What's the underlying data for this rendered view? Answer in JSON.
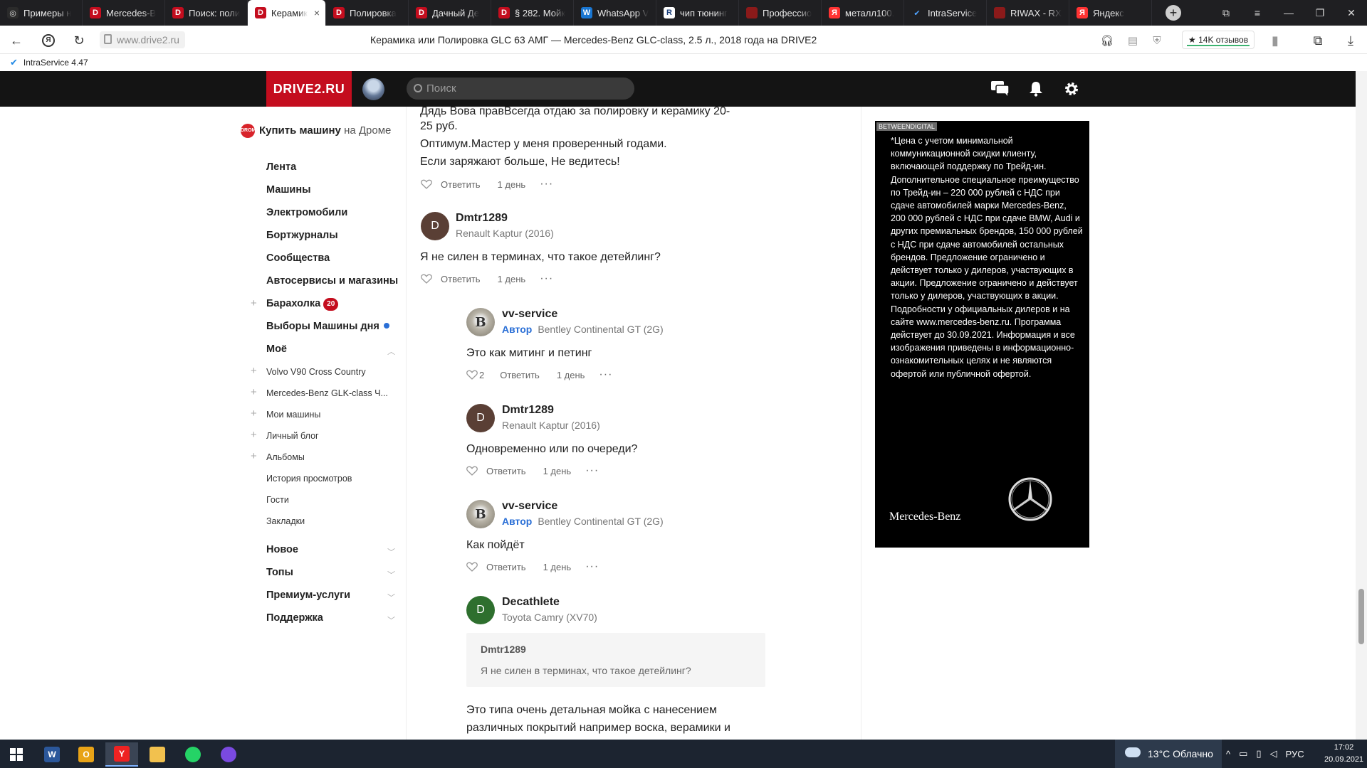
{
  "browser": {
    "tabs": [
      {
        "label": "Примеры н",
        "icon": "settings-icon",
        "color": "#2b2b2b"
      },
      {
        "label": "Mercedes-B",
        "icon": "drive2-icon",
        "color": "#c40d1e"
      },
      {
        "label": "Поиск: поли",
        "icon": "drive2-icon",
        "color": "#c40d1e"
      },
      {
        "label": "Керамик",
        "icon": "drive2-icon",
        "color": "#c40d1e",
        "active": true
      },
      {
        "label": "Полировка",
        "icon": "drive2-icon",
        "color": "#c40d1e"
      },
      {
        "label": "Дачный Де",
        "icon": "drive2-icon",
        "color": "#c40d1e"
      },
      {
        "label": "§ 282. Мойк",
        "icon": "drive2-icon",
        "color": "#c40d1e"
      },
      {
        "label": "WhatsApp V",
        "icon": "whatsapp-web-icon",
        "color": "#1976d2"
      },
      {
        "label": "чип тюнинг",
        "icon": "chip-icon",
        "color": "#ffffff"
      },
      {
        "label": "Профессио",
        "icon": "pdf-icon",
        "color": "#8b1a1a"
      },
      {
        "label": "металл100.",
        "icon": "yandex-icon",
        "color": "#f33"
      },
      {
        "label": "IntraService",
        "icon": "check-icon",
        "color": "#1e88e5"
      },
      {
        "label": "RIWAX - RX",
        "icon": "riwax-icon",
        "color": "#8b1a1a"
      },
      {
        "label": "Яндекс",
        "icon": "yandex-icon",
        "color": "#f33"
      }
    ],
    "url": "www.drive2.ru",
    "page_title": "Керамика или Полировка GLC 63 АМГ — Mercedes-Benz GLC-class, 2.5 л., 2018 года на DRIVE2",
    "reviews": "★ 14K отзывов",
    "bookmark": "IntraService 4.47",
    "new_tab": "+",
    "tab_close": "×"
  },
  "header": {
    "logo": "DRIVE2.RU",
    "search_placeholder": "Поиск"
  },
  "sidebar": {
    "buy": {
      "drom_icon": "DROM",
      "bold": "Купить машину",
      "rest": "на Дроме"
    },
    "main_items": [
      {
        "label": "Лента"
      },
      {
        "label": "Машины"
      },
      {
        "label": "Электромобили"
      },
      {
        "label": "Бортжурналы"
      },
      {
        "label": "Сообщества"
      },
      {
        "label": "Автосервисы и магазины"
      },
      {
        "label": "Барахолка",
        "badge": "20"
      },
      {
        "label": "Выборы Машины дня"
      }
    ],
    "my_title": "Моё",
    "my_items": [
      "Volvo V90 Cross Country",
      "Mercedes-Benz GLK-class Ч...",
      "Мои машины",
      "Личный блог",
      "Альбомы",
      "История просмотров",
      "Гости",
      "Закладки"
    ],
    "sections": [
      "Новое",
      "Топы",
      "Премиум-услуги",
      "Поддержка"
    ]
  },
  "comments": {
    "c0": {
      "lines": [
        "Дядь Вова правВсегда отдаю за полировку и керамику 20-",
        "25 руб.",
        "Оптимум.Мастер у меня проверенный годами.",
        "Если заряжают больше, Не ведитесь!"
      ],
      "reply": "Ответить",
      "date": "1 день",
      "more": "···"
    },
    "c1": {
      "initial": "D",
      "user": "Dmtr1289",
      "car": "Renault Kaptur (2016)",
      "text": "Я не силен в терминах, что такое детейлинг?",
      "reply": "Ответить",
      "date": "1 день",
      "more": "···"
    },
    "c2": {
      "initial": "B",
      "user": "vv-service",
      "author": "Автор",
      "car": "Bentley Continental GT (2G)",
      "text": "Это как митинг и петинг",
      "likes": "2",
      "reply": "Ответить",
      "date": "1 день",
      "more": "···"
    },
    "c3": {
      "initial": "D",
      "user": "Dmtr1289",
      "car": "Renault Kaptur (2016)",
      "text": "Одновременно или по очереди?",
      "reply": "Ответить",
      "date": "1 день",
      "more": "···"
    },
    "c4": {
      "initial": "B",
      "user": "vv-service",
      "author": "Автор",
      "car": "Bentley Continental GT (2G)",
      "text": "Как пойдёт",
      "reply": "Ответить",
      "date": "1 день",
      "more": "···"
    },
    "c5": {
      "initial": "D",
      "user": "Decathlete",
      "car": "Toyota Camry (XV70)",
      "quote_user": "Dmtr1289",
      "quote_text": "Я не силен в терминах, что такое детейлинг?",
      "lines": [
        "Это типа очень детальная мойка с нанесением",
        "различных покрытий например воска, верамики и"
      ]
    }
  },
  "ad": {
    "tag": "BETWEENDIGITAL",
    "text": "*Цена с учетом минимальной коммуникационной скидки клиенту, включающей поддержку по Трейд-ин. Дополнительное специальное преимущество по Трейд-ин – 220 000 рублей с НДС при сдаче автомобилей марки Mercedes-Benz, 200 000 рублей с НДС при сдаче BMW, Audi и других премиальных брендов, 150 000 рублей с НДС при сдаче автомобилей остальных брендов. Предложение ограничено и действует только у дилеров, участвующих в акции. Предложение ограничено и действует только у дилеров, участвующих в акции. Подробности у официальных дилеров и на сайте www.mercedes-benz.ru. Программа действует до 30.09.2021. Информация и все изображения приведены в информационно-ознакомительных целях и не являются офертой или публичной офертой.",
    "brand": "Mercedes-Benz"
  },
  "taskbar": {
    "apps": [
      {
        "name": "word",
        "label": "W",
        "color": "#2b579a"
      },
      {
        "name": "outlook",
        "label": "O",
        "color": "#e8a317"
      },
      {
        "name": "yandex-browser",
        "label": "Y",
        "color": "#e22",
        "active": true
      },
      {
        "name": "file-explorer",
        "label": "",
        "color": "#f2c14e"
      },
      {
        "name": "whatsapp",
        "label": "",
        "color": "#25d366"
      },
      {
        "name": "drop-app",
        "label": "",
        "color": "#7a4ae0"
      }
    ],
    "weather": "13°C  Облачно",
    "lang": "РУС",
    "time": "17:02",
    "date": "20.09.2021"
  }
}
